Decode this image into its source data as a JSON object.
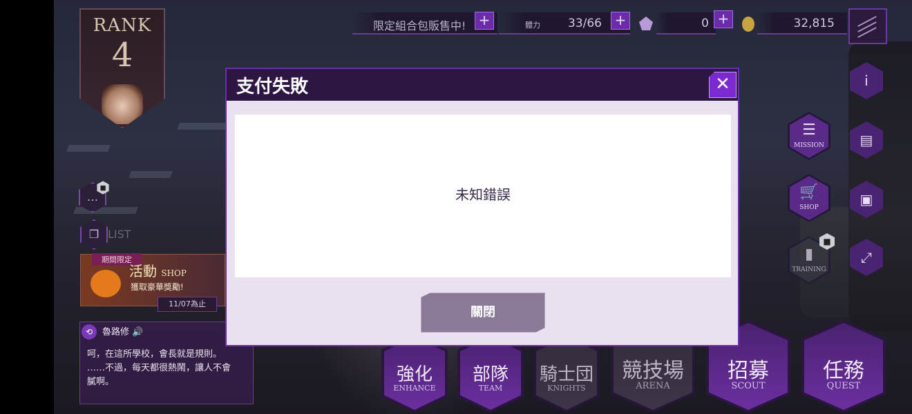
{
  "topbar": {
    "promo": "限定組合包販售中!",
    "stamina_label": "體力",
    "stamina_value": "33/66",
    "gems_value": "0",
    "coins_value": "32,815"
  },
  "rank": {
    "label": "RANK",
    "value": "4"
  },
  "side": {
    "list_label": "LIST"
  },
  "event": {
    "tag": "期間限定",
    "title": "活動",
    "title_suffix": "SHOP",
    "subtitle": "獲取豪華獎勵!",
    "deadline": "11/07為止"
  },
  "dialogue": {
    "speaker": "魯路修",
    "lines": [
      "呵，在這所學校，會長就是規則。",
      "……不過，每天都很熱鬧，讓人不會",
      "膩啊。"
    ]
  },
  "right_buttons": {
    "mission": "MISSION",
    "shop": "SHOP",
    "training": "TRAINING"
  },
  "nav": [
    {
      "cn": "強化",
      "en": "ENHANCE"
    },
    {
      "cn": "部隊",
      "en": "TEAM"
    },
    {
      "cn": "騎士団",
      "en": "KNIGHTS"
    },
    {
      "cn": "競技場",
      "en": "ARENA"
    },
    {
      "cn": "招募",
      "en": "SCOUT"
    },
    {
      "cn": "任務",
      "en": "QUEST"
    }
  ],
  "modal": {
    "title": "支付失敗",
    "message": "未知錯誤",
    "close_button": "關閉"
  },
  "colors": {
    "accent": "#6b2fa8",
    "header": "#2e1642",
    "close_button": "#7a2ad0",
    "modal_bg": "#e9e0f0"
  },
  "icons": [
    "plus-icon",
    "crystal-icon",
    "coin-icon",
    "menu-icon",
    "info-icon",
    "chest-icon",
    "profile-icon",
    "expand-icon",
    "lock-icon",
    "chat-icon",
    "close-icon"
  ]
}
